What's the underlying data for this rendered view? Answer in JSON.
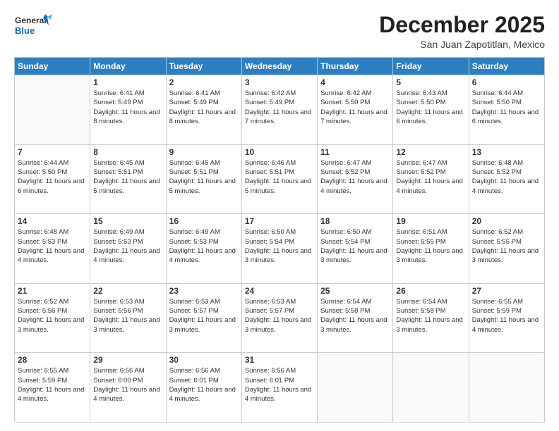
{
  "header": {
    "logo_line1": "General",
    "logo_line2": "Blue",
    "month": "December 2025",
    "location": "San Juan Zapotitlan, Mexico"
  },
  "days_of_week": [
    "Sunday",
    "Monday",
    "Tuesday",
    "Wednesday",
    "Thursday",
    "Friday",
    "Saturday"
  ],
  "weeks": [
    [
      {
        "day": "",
        "sunrise": "",
        "sunset": "",
        "daylight": "",
        "empty": true
      },
      {
        "day": "1",
        "sunrise": "Sunrise: 6:41 AM",
        "sunset": "Sunset: 5:49 PM",
        "daylight": "Daylight: 11 hours and 8 minutes."
      },
      {
        "day": "2",
        "sunrise": "Sunrise: 6:41 AM",
        "sunset": "Sunset: 5:49 PM",
        "daylight": "Daylight: 11 hours and 8 minutes."
      },
      {
        "day": "3",
        "sunrise": "Sunrise: 6:42 AM",
        "sunset": "Sunset: 5:49 PM",
        "daylight": "Daylight: 11 hours and 7 minutes."
      },
      {
        "day": "4",
        "sunrise": "Sunrise: 6:42 AM",
        "sunset": "Sunset: 5:50 PM",
        "daylight": "Daylight: 11 hours and 7 minutes."
      },
      {
        "day": "5",
        "sunrise": "Sunrise: 6:43 AM",
        "sunset": "Sunset: 5:50 PM",
        "daylight": "Daylight: 11 hours and 6 minutes."
      },
      {
        "day": "6",
        "sunrise": "Sunrise: 6:44 AM",
        "sunset": "Sunset: 5:50 PM",
        "daylight": "Daylight: 11 hours and 6 minutes."
      }
    ],
    [
      {
        "day": "7",
        "sunrise": "Sunrise: 6:44 AM",
        "sunset": "Sunset: 5:50 PM",
        "daylight": "Daylight: 11 hours and 6 minutes."
      },
      {
        "day": "8",
        "sunrise": "Sunrise: 6:45 AM",
        "sunset": "Sunset: 5:51 PM",
        "daylight": "Daylight: 11 hours and 5 minutes."
      },
      {
        "day": "9",
        "sunrise": "Sunrise: 6:45 AM",
        "sunset": "Sunset: 5:51 PM",
        "daylight": "Daylight: 11 hours and 5 minutes."
      },
      {
        "day": "10",
        "sunrise": "Sunrise: 6:46 AM",
        "sunset": "Sunset: 5:51 PM",
        "daylight": "Daylight: 11 hours and 5 minutes."
      },
      {
        "day": "11",
        "sunrise": "Sunrise: 6:47 AM",
        "sunset": "Sunset: 5:52 PM",
        "daylight": "Daylight: 11 hours and 4 minutes."
      },
      {
        "day": "12",
        "sunrise": "Sunrise: 6:47 AM",
        "sunset": "Sunset: 5:52 PM",
        "daylight": "Daylight: 11 hours and 4 minutes."
      },
      {
        "day": "13",
        "sunrise": "Sunrise: 6:48 AM",
        "sunset": "Sunset: 5:52 PM",
        "daylight": "Daylight: 11 hours and 4 minutes."
      }
    ],
    [
      {
        "day": "14",
        "sunrise": "Sunrise: 6:48 AM",
        "sunset": "Sunset: 5:53 PM",
        "daylight": "Daylight: 11 hours and 4 minutes."
      },
      {
        "day": "15",
        "sunrise": "Sunrise: 6:49 AM",
        "sunset": "Sunset: 5:53 PM",
        "daylight": "Daylight: 11 hours and 4 minutes."
      },
      {
        "day": "16",
        "sunrise": "Sunrise: 6:49 AM",
        "sunset": "Sunset: 5:53 PM",
        "daylight": "Daylight: 11 hours and 4 minutes."
      },
      {
        "day": "17",
        "sunrise": "Sunrise: 6:50 AM",
        "sunset": "Sunset: 5:54 PM",
        "daylight": "Daylight: 11 hours and 3 minutes."
      },
      {
        "day": "18",
        "sunrise": "Sunrise: 6:50 AM",
        "sunset": "Sunset: 5:54 PM",
        "daylight": "Daylight: 11 hours and 3 minutes."
      },
      {
        "day": "19",
        "sunrise": "Sunrise: 6:51 AM",
        "sunset": "Sunset: 5:55 PM",
        "daylight": "Daylight: 11 hours and 3 minutes."
      },
      {
        "day": "20",
        "sunrise": "Sunrise: 6:52 AM",
        "sunset": "Sunset: 5:55 PM",
        "daylight": "Daylight: 11 hours and 3 minutes."
      }
    ],
    [
      {
        "day": "21",
        "sunrise": "Sunrise: 6:52 AM",
        "sunset": "Sunset: 5:56 PM",
        "daylight": "Daylight: 11 hours and 3 minutes."
      },
      {
        "day": "22",
        "sunrise": "Sunrise: 6:53 AM",
        "sunset": "Sunset: 5:56 PM",
        "daylight": "Daylight: 11 hours and 3 minutes."
      },
      {
        "day": "23",
        "sunrise": "Sunrise: 6:53 AM",
        "sunset": "Sunset: 5:57 PM",
        "daylight": "Daylight: 11 hours and 3 minutes."
      },
      {
        "day": "24",
        "sunrise": "Sunrise: 6:53 AM",
        "sunset": "Sunset: 5:57 PM",
        "daylight": "Daylight: 11 hours and 3 minutes."
      },
      {
        "day": "25",
        "sunrise": "Sunrise: 6:54 AM",
        "sunset": "Sunset: 5:58 PM",
        "daylight": "Daylight: 11 hours and 3 minutes."
      },
      {
        "day": "26",
        "sunrise": "Sunrise: 6:54 AM",
        "sunset": "Sunset: 5:58 PM",
        "daylight": "Daylight: 11 hours and 3 minutes."
      },
      {
        "day": "27",
        "sunrise": "Sunrise: 6:55 AM",
        "sunset": "Sunset: 5:59 PM",
        "daylight": "Daylight: 11 hours and 4 minutes."
      }
    ],
    [
      {
        "day": "28",
        "sunrise": "Sunrise: 6:55 AM",
        "sunset": "Sunset: 5:59 PM",
        "daylight": "Daylight: 11 hours and 4 minutes."
      },
      {
        "day": "29",
        "sunrise": "Sunrise: 6:56 AM",
        "sunset": "Sunset: 6:00 PM",
        "daylight": "Daylight: 11 hours and 4 minutes."
      },
      {
        "day": "30",
        "sunrise": "Sunrise: 6:56 AM",
        "sunset": "Sunset: 6:01 PM",
        "daylight": "Daylight: 11 hours and 4 minutes."
      },
      {
        "day": "31",
        "sunrise": "Sunrise: 6:56 AM",
        "sunset": "Sunset: 6:01 PM",
        "daylight": "Daylight: 11 hours and 4 minutes."
      },
      {
        "day": "",
        "sunrise": "",
        "sunset": "",
        "daylight": "",
        "empty": true
      },
      {
        "day": "",
        "sunrise": "",
        "sunset": "",
        "daylight": "",
        "empty": true
      },
      {
        "day": "",
        "sunrise": "",
        "sunset": "",
        "daylight": "",
        "empty": true
      }
    ]
  ]
}
